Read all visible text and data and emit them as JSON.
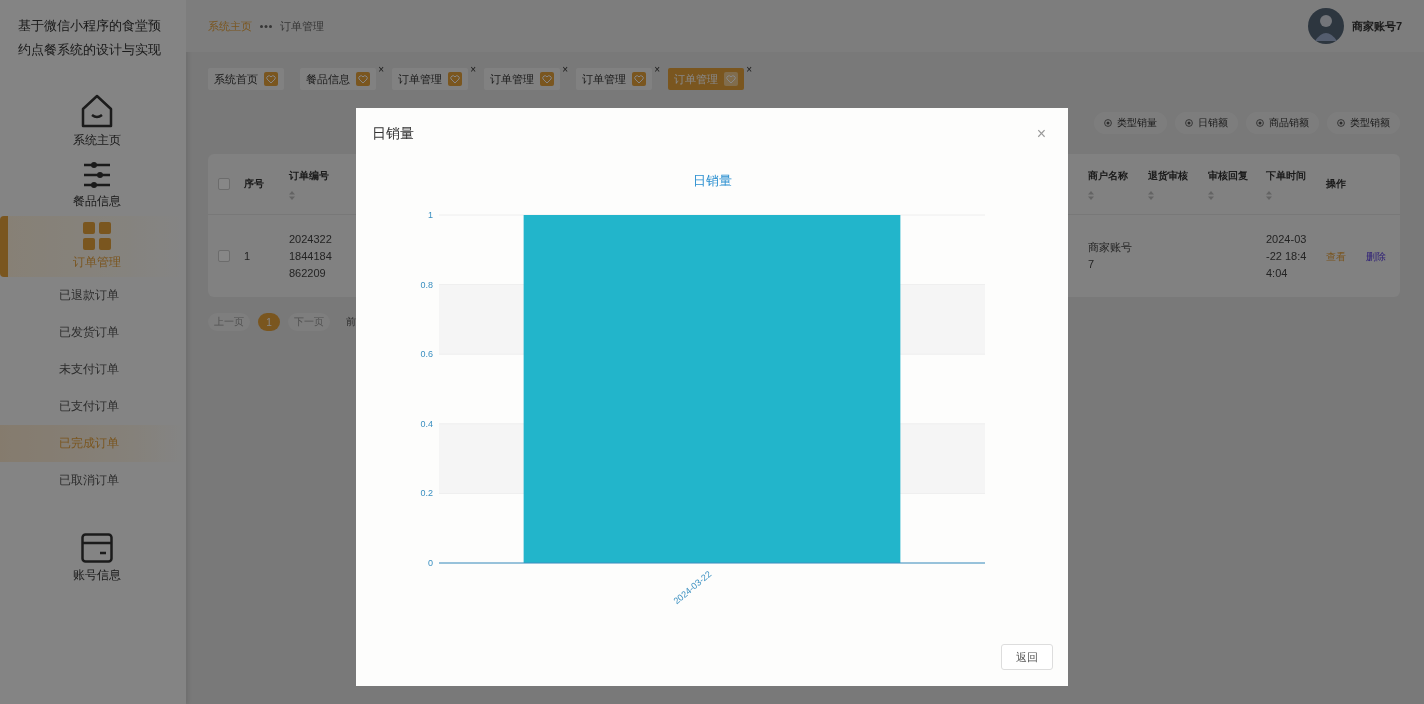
{
  "sidebar": {
    "title": "基于微信小程序的食堂预约点餐系统的设计与实现",
    "items": [
      {
        "label": "系统主页",
        "kind": "home",
        "selected": false
      },
      {
        "label": "餐品信息",
        "kind": "sliders",
        "selected": false
      },
      {
        "label": "订单管理",
        "kind": "grid",
        "selected": true,
        "children": [
          {
            "label": "已退款订单",
            "selected": false
          },
          {
            "label": "已发货订单",
            "selected": false
          },
          {
            "label": "未支付订单",
            "selected": false
          },
          {
            "label": "已支付订单",
            "selected": false
          },
          {
            "label": "已完成订单",
            "selected": true
          },
          {
            "label": "已取消订单",
            "selected": false
          }
        ]
      },
      {
        "label": "账号信息",
        "kind": "card",
        "selected": false
      }
    ]
  },
  "header": {
    "breadcrumb": [
      "系统主页",
      "订单管理"
    ],
    "user": {
      "name": "商家账号7"
    }
  },
  "tabs": [
    {
      "label": "系统首页",
      "closable": false,
      "selected": false
    },
    {
      "label": "餐品信息",
      "closable": true,
      "close": "×",
      "selected": false
    },
    {
      "label": "订单管理",
      "closable": true,
      "close": "×",
      "selected": false
    },
    {
      "label": "订单管理",
      "closable": true,
      "close": "×",
      "selected": false
    },
    {
      "label": "订单管理",
      "closable": true,
      "close": "×",
      "selected": false
    },
    {
      "label": "订单管理",
      "closable": true,
      "close": "×",
      "selected": true
    }
  ],
  "chart_buttons": [
    "类型销量",
    "日销额",
    "商品销额",
    "类型销额"
  ],
  "table": {
    "all_checked": false,
    "columns": [
      {
        "label": "序号",
        "sortable": false
      },
      {
        "label": "订单编号",
        "sortable": true
      },
      {
        "label": "商户名称",
        "sortable": true
      },
      {
        "label": "退货审核",
        "sortable": true
      },
      {
        "label": "审核回复",
        "sortable": true
      },
      {
        "label": "下单时间",
        "sortable": true
      },
      {
        "label": "操作",
        "sortable": false
      }
    ],
    "rows": [
      {
        "checked": false,
        "cells": [
          "1",
          "20243221844184862209",
          "商家账号7",
          "",
          "",
          "2024-03-22 18:44:04"
        ],
        "actions": [
          "查看",
          "删除"
        ]
      }
    ]
  },
  "pagination": {
    "prev": "上一页",
    "pages": [
      {
        "label": "1",
        "selected": true
      }
    ],
    "next": "下一页",
    "jump": "前"
  },
  "dialog": {
    "title": "日销量",
    "close": "×",
    "button": "返回",
    "chart_data": {
      "type": "bar",
      "title": "日销量",
      "categories": [
        "2024-03-22"
      ],
      "values": [
        1
      ],
      "grid": true,
      "ylim": [
        0,
        1
      ],
      "yticks": [
        0,
        0.2,
        0.4,
        0.6,
        0.8,
        1
      ]
    }
  }
}
